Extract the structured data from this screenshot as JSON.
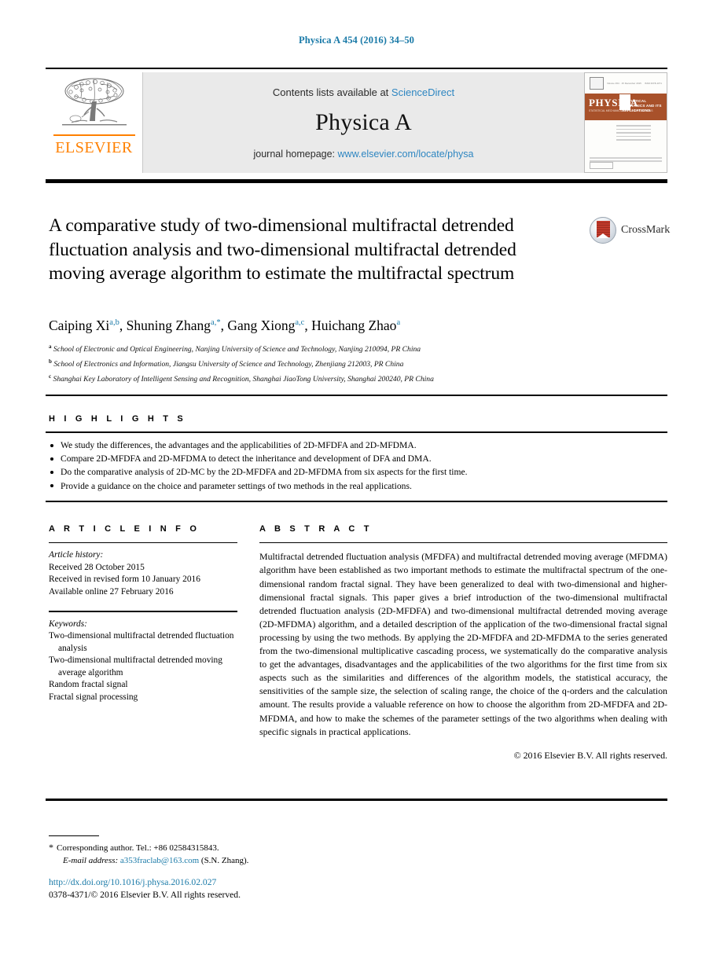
{
  "running_head": "Physica A 454 (2016) 34–50",
  "masthead": {
    "contents_prefix": "Contents lists available at ",
    "contents_link": "ScienceDirect",
    "journal_name": "Physica A",
    "homepage_prefix": "journal homepage: ",
    "homepage_link": "www.elsevier.com/locate/physa",
    "publisher_logo_text": "ELSEVIER",
    "cover": {
      "banner_title": "PHYSICA",
      "banner_subtitle": "STATISTICAL MECHANICS AND ITS APPLICATIONS",
      "banner_side_title": "STATISTICAL MECHANICS AND ITS APPLICATIONS"
    }
  },
  "article": {
    "title": "A comparative study of two-dimensional multifractal detrended fluctuation analysis and two-dimensional multifractal detrended moving average algorithm to estimate the multifractal spectrum",
    "crossmark_label": "CrossMark",
    "authors": [
      {
        "name": "Caiping Xi",
        "marks": "a,b",
        "sep": ", "
      },
      {
        "name": "Shuning Zhang",
        "marks": "a,*",
        "sep": ", "
      },
      {
        "name": "Gang Xiong",
        "marks": "a,c",
        "sep": ", "
      },
      {
        "name": "Huichang Zhao",
        "marks": "a",
        "sep": ""
      }
    ],
    "affiliations": [
      {
        "mark": "a",
        "text": "School of Electronic and Optical Engineering, Nanjing University of Science and Technology, Nanjing 210094, PR China"
      },
      {
        "mark": "b",
        "text": "School of Electronics and Information, Jiangsu University of Science and Technology, Zhenjiang 212003, PR China"
      },
      {
        "mark": "c",
        "text": "Shanghai Key Laboratory of Intelligent Sensing and Recognition, Shanghai JiaoTong University, Shanghai 200240, PR China"
      }
    ]
  },
  "highlights": {
    "heading": "H I G H L I G H T S",
    "items": [
      "We study the differences, the advantages and the applicabilities of 2D-MFDFA and 2D-MFDMA.",
      "Compare 2D-MFDFA and 2D-MFDMA to detect the inheritance and development of DFA and DMA.",
      "Do the comparative analysis of 2D-MC by the 2D-MFDFA and 2D-MFDMA from six aspects for the first time.",
      "Provide a guidance on the choice and parameter settings of two methods in the real applications."
    ]
  },
  "article_info": {
    "heading": "A R T I C L E   I N F O",
    "history_label": "Article history:",
    "history": [
      "Received 28 October 2015",
      "Received in revised form 10 January 2016",
      "Available online 27 February 2016"
    ],
    "keywords_label": "Keywords:",
    "keywords": [
      "Two-dimensional multifractal detrended fluctuation analysis",
      "Two-dimensional multifractal detrended moving average algorithm",
      "Random fractal signal",
      "Fractal signal processing"
    ]
  },
  "abstract": {
    "heading": "A B S T R A C T",
    "body": "Multifractal detrended fluctuation analysis (MFDFA) and multifractal detrended moving average (MFDMA) algorithm have been established as two important methods to estimate the multifractal spectrum of the one-dimensional random fractal signal. They have been generalized to deal with two-dimensional and higher-dimensional fractal signals. This paper gives a brief introduction of the two-dimensional multifractal detrended fluctuation analysis (2D-MFDFA) and two-dimensional multifractal detrended moving average (2D-MFDMA) algorithm, and a detailed description of the application of the two-dimensional fractal signal processing by using the two methods. By applying the 2D-MFDFA and 2D-MFDMA to the series generated from the two-dimensional multiplicative cascading process, we systematically do the comparative analysis to get the advantages, disadvantages and the applicabilities of the two algorithms for the first time from six aspects such as the similarities and differences of the algorithm models, the statistical accuracy, the sensitivities of the sample size, the selection of scaling range, the choice of the q-orders and the calculation amount. The results provide a valuable reference on how to choose the algorithm from 2D-MFDFA and 2D-MFDMA, and how to make the schemes of the parameter settings of the two algorithms when dealing with specific signals in practical applications.",
    "copyright": "© 2016 Elsevier B.V. All rights reserved."
  },
  "footer": {
    "corresponding_star": "*",
    "corresponding_text": "Corresponding author. Tel.: +86 02584315843.",
    "email_label": "E-mail address:",
    "email_link": "a353fraclab@163.com",
    "email_suffix": "(S.N. Zhang).",
    "doi": "http://dx.doi.org/10.1016/j.physa.2016.02.027",
    "issn": "0378-4371/© 2016 Elsevier B.V. All rights reserved."
  },
  "colors": {
    "link_blue": "#1a7aa8",
    "sciencedirect_blue": "#2e86c1",
    "elsevier_orange": "#ff8000",
    "cover_band": "#a8512a",
    "masthead_gray": "#eaeaea"
  }
}
